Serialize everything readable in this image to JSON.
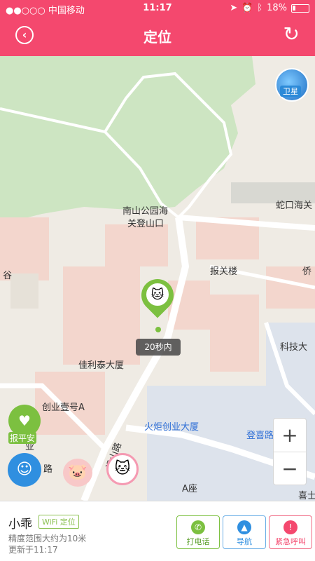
{
  "status_bar": {
    "carrier": "●●○○○ 中国移动",
    "time": "11:17",
    "battery": "18%"
  },
  "header": {
    "title": "定位",
    "back_icon": "back-arrow-icon",
    "refresh_icon": "refresh-icon"
  },
  "map": {
    "satellite_label": "卫星",
    "labels": {
      "park_line1": "南山公园海",
      "park_line2": "关登山口",
      "customs_tower": "报关楼",
      "shekou": "蛇口海关",
      "qiao": "侨",
      "jiali": "佳利泰大厦",
      "keji": "科技大",
      "chuangye": "创业壹号A",
      "huoju": "火炬创业大厦",
      "dengxi": "登喜路",
      "road": "沿山路",
      "a_block": "A座",
      "xi": "喜士",
      "gu": "谷",
      "ye": "业",
      "lu": "路"
    },
    "location_time": "20秒内",
    "baoping_label": "报平安",
    "zoom_in": "+",
    "zoom_out": "−"
  },
  "panel": {
    "name": "小乖",
    "mode_badge": "WiFi 定位",
    "accuracy": "精度范围大约为10米",
    "updated": "更新于11:17",
    "actions": {
      "call": "打电话",
      "navigate": "导航",
      "sos": "紧急呼叫"
    }
  },
  "colors": {
    "brand": "#f4486e",
    "green": "#7cc040",
    "blue": "#2f8fe0"
  }
}
